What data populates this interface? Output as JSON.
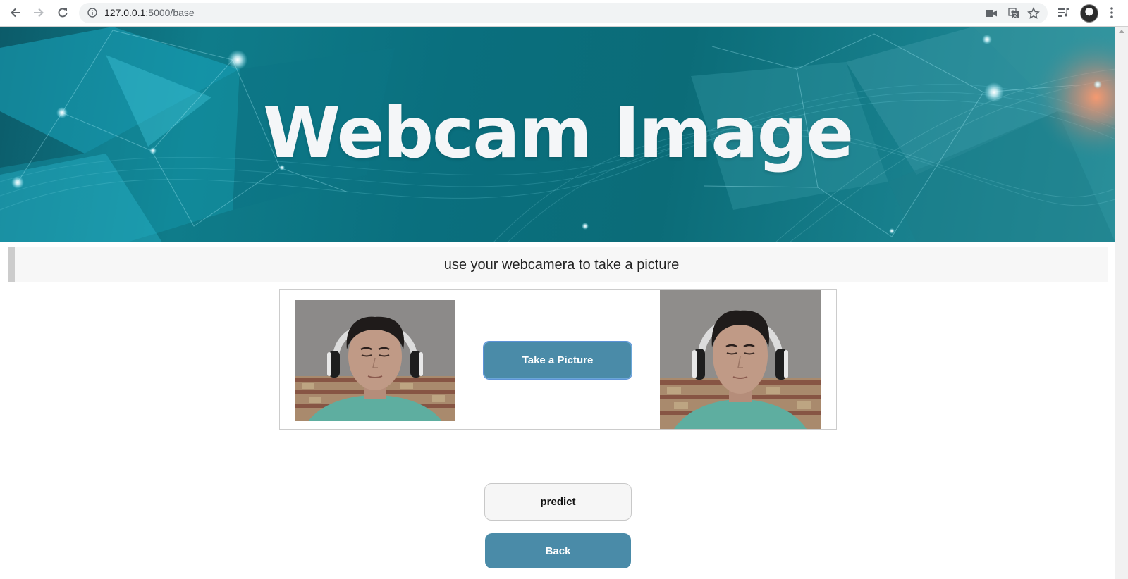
{
  "browser": {
    "url_host": "127.0.0.1",
    "url_rest": ":5000/base",
    "icons": [
      "back-arrow-icon",
      "forward-arrow-icon",
      "reload-icon",
      "info-icon",
      "camera-icon",
      "translate-icon",
      "star-icon",
      "media-queue-icon",
      "profile-avatar",
      "menu-dots-icon"
    ]
  },
  "banner": {
    "title": "Webcam Image"
  },
  "subtitle": "use your webcamera to take a picture",
  "camera": {
    "take_picture_label": "Take a Picture"
  },
  "actions": {
    "predict_label": "predict",
    "back_label": "Back"
  },
  "colors": {
    "button_accent": "#4a8ba8",
    "banner_teal": "#0f7c8a",
    "subtitle_bg": "#f7f7f7",
    "subtitle_border": "#cccccc"
  }
}
